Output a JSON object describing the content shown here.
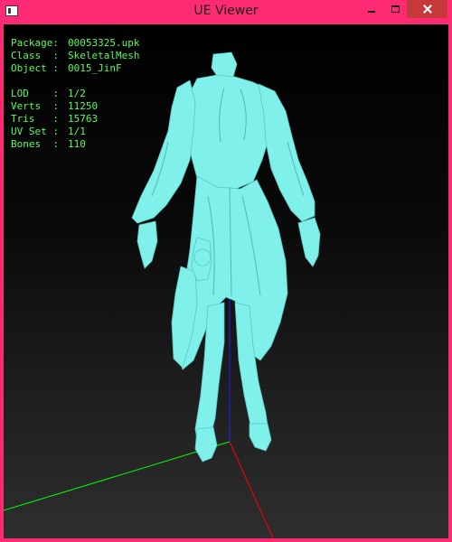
{
  "window": {
    "title": "UE Viewer"
  },
  "info": {
    "package_key": "Package:",
    "package_value": "00053325.upk",
    "class_key": "Class  :",
    "class_value": "SkeletalMesh",
    "object_key": "Object :",
    "object_value": "0015_JinF",
    "lod_key": "LOD    :",
    "lod_value": "1/2",
    "verts_key": "Verts  :",
    "verts_value": "11250",
    "tris_key": "Tris   :",
    "tris_value": "15763",
    "uvset_key": "UV Set :",
    "uvset_value": "1/1",
    "bones_key": "Bones  :",
    "bones_value": "110"
  },
  "colors": {
    "window_frame": "#ff2a74",
    "close_button": "#c7383a",
    "info_text": "#55ff55",
    "mesh": "#7ff0ea",
    "axis_x": "#ff0000",
    "axis_y": "#00ff00",
    "axis_z": "#2020ff"
  },
  "icons": {
    "app": "app-icon",
    "minimize": "minimize-icon",
    "maximize": "maximize-icon",
    "close": "close-icon"
  }
}
